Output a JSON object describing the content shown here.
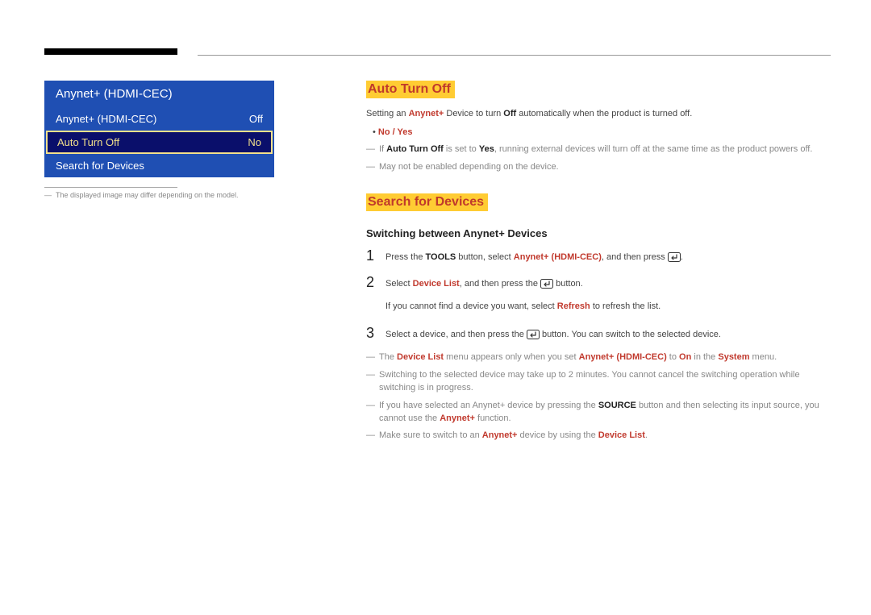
{
  "menu": {
    "title": "Anynet+ (HDMI-CEC)",
    "rows": [
      {
        "label": "Anynet+ (HDMI-CEC)",
        "value": "Off"
      },
      {
        "label": "Auto Turn Off",
        "value": "No"
      },
      {
        "label": "Search for Devices",
        "value": ""
      }
    ],
    "caption": "The displayed image may differ depending on the model."
  },
  "section_auto_turn_off": {
    "heading": "Auto Turn Off",
    "intro_pre": "Setting an ",
    "intro_r1": "Anynet+",
    "intro_mid1": " Device to turn ",
    "intro_b1": "Off",
    "intro_post": " automatically when the product is turned off.",
    "options": "No / Yes",
    "note1_pre": "If ",
    "note1_b1": "Auto Turn Off",
    "note1_mid": " is set to ",
    "note1_b2": "Yes",
    "note1_post": ", running external devices will turn off at the same time as the product powers off.",
    "note2": "May not be enabled depending on the device."
  },
  "section_search": {
    "heading": "Search for Devices",
    "subheading": "Switching between Anynet+ Devices",
    "step1_pre": "Press the ",
    "step1_b1": "TOOLS",
    "step1_mid1": " button, select ",
    "step1_r1": "Anynet+ (HDMI-CEC)",
    "step1_mid2": ", and then press ",
    "step1_post": ".",
    "step2_pre": "Select ",
    "step2_r1": "Device List",
    "step2_mid": ", and then press the ",
    "step2_post": " button.",
    "step2_extra_pre": "If you cannot find a device you want, select ",
    "step2_extra_r1": "Refresh",
    "step2_extra_post": " to refresh the list.",
    "step3_pre": "Select a device, and then press the ",
    "step3_post": " button. You can switch to the selected device.",
    "noteA_pre": "The ",
    "noteA_r1": "Device List",
    "noteA_mid1": " menu appears only when you set ",
    "noteA_r2": "Anynet+ (HDMI-CEC)",
    "noteA_mid2": " to ",
    "noteA_r3": "On",
    "noteA_mid3": " in the ",
    "noteA_r4": "System",
    "noteA_post": " menu.",
    "noteB": "Switching to the selected device may take up to 2 minutes. You cannot cancel the switching operation while switching is in progress.",
    "noteC_pre": "If you have selected an Anynet+ device by pressing the ",
    "noteC_b1": "SOURCE",
    "noteC_mid": " button and then selecting its input source, you cannot use the ",
    "noteC_r1": "Anynet+",
    "noteC_post": " function.",
    "noteD_pre": "Make sure to switch to an ",
    "noteD_r1": "Anynet+",
    "noteD_mid": " device by using the ",
    "noteD_r2": "Device List",
    "noteD_post": "."
  },
  "nums": {
    "one": "1",
    "two": "2",
    "three": "3"
  }
}
